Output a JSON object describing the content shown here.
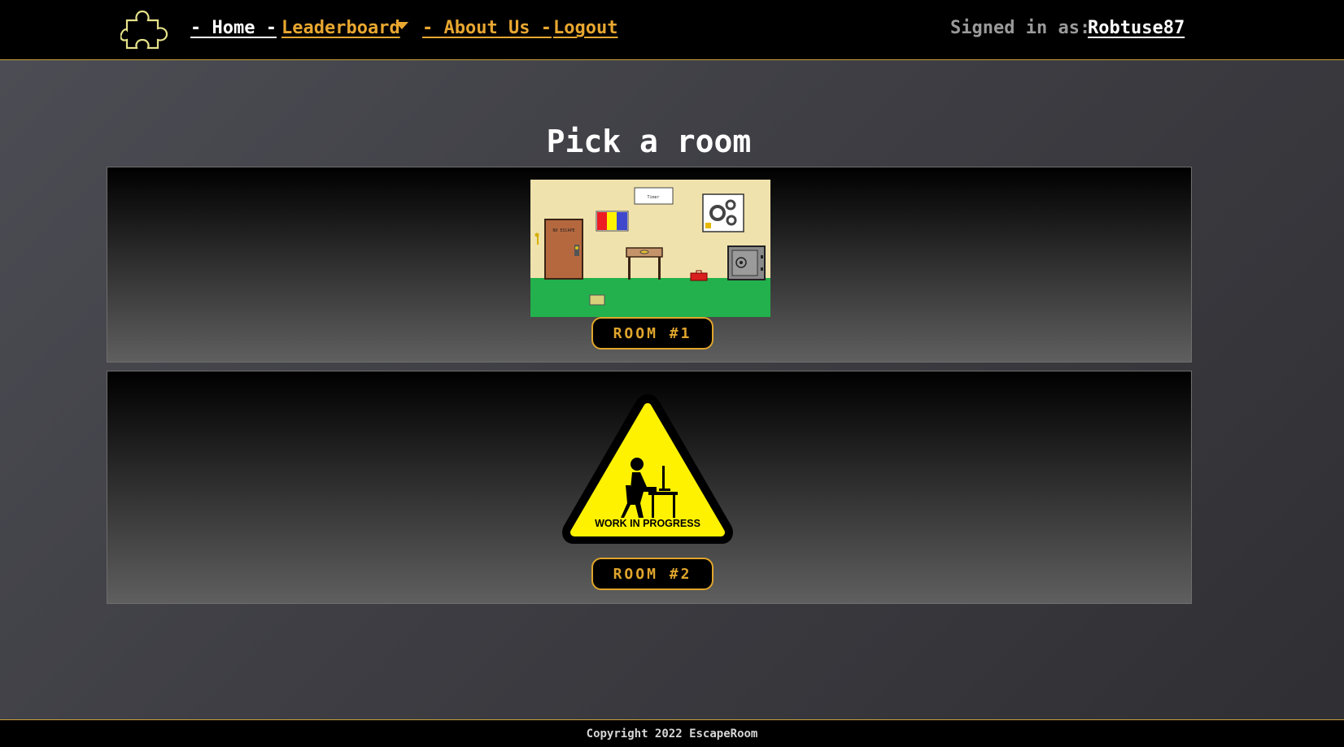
{
  "nav": {
    "home": "- Home -",
    "leaderboard": "Leaderboard",
    "about": "- About Us -",
    "logout": "Logout",
    "signed_in_label": "Signed in as:",
    "username": "Robtuse87",
    "logo_icon": "puzzle-piece-icon",
    "accent_color": "#e8a730"
  },
  "main": {
    "title": "Pick a room",
    "rooms": [
      {
        "button": "ROOM #1",
        "image": "escape-room-illustration",
        "door_sign": "NO ESCAPE",
        "wall_sign": "Timer"
      },
      {
        "button": "ROOM #2",
        "image": "work-in-progress-sign",
        "sign_text": "WORK IN PROGRESS"
      }
    ]
  },
  "footer": {
    "copyright": "Copyright 2022 EscapeRoom"
  }
}
